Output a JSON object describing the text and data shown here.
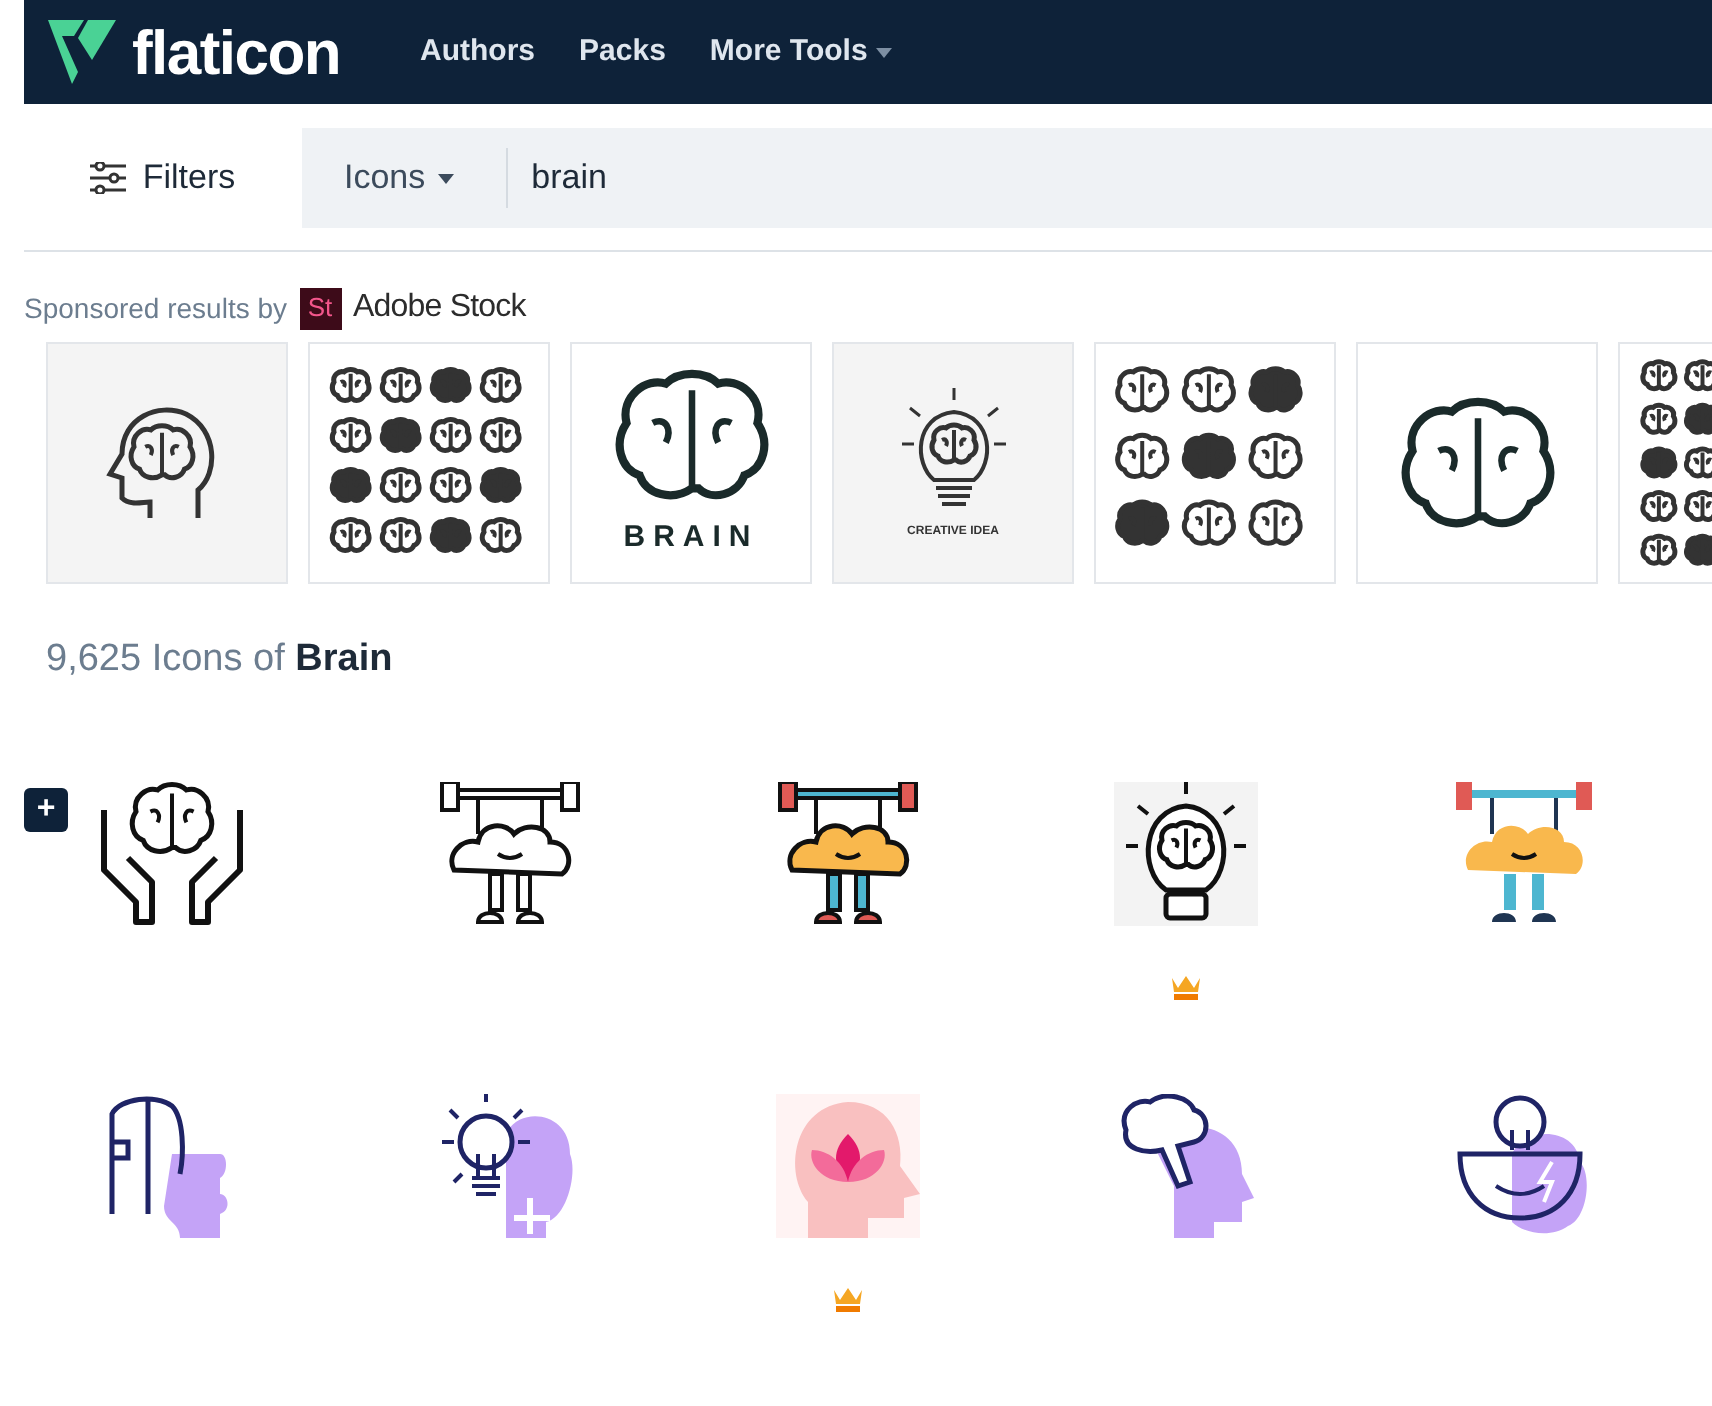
{
  "header": {
    "logo": "flaticon",
    "nav": [
      {
        "label": "Authors",
        "dropdown": false
      },
      {
        "label": "Packs",
        "dropdown": false
      },
      {
        "label": "More Tools",
        "dropdown": true
      }
    ]
  },
  "search": {
    "filters": "Filters",
    "type": "Icons",
    "value": "brain"
  },
  "sponsored": {
    "label": "Sponsored results by",
    "badge": "St",
    "brand": "Adobe Stock",
    "thumbs": [
      {
        "kind": "head"
      },
      {
        "kind": "grid16"
      },
      {
        "kind": "brain",
        "caption": "BRAIN"
      },
      {
        "kind": "bulb",
        "caption": "CREATIVE IDEA"
      },
      {
        "kind": "grid9"
      },
      {
        "kind": "brain"
      },
      {
        "kind": "grid-small"
      }
    ]
  },
  "results": {
    "count": "9,625",
    "text": "Icons of",
    "term": "Brain",
    "add_button": "+",
    "icons": [
      {
        "kind": "hands-brain",
        "premium": false
      },
      {
        "kind": "lifter-outline",
        "premium": false
      },
      {
        "kind": "lifter-color",
        "premium": false
      },
      {
        "kind": "bulb-brain",
        "premium": true
      },
      {
        "kind": "lifter-flat",
        "premium": false
      },
      {
        "kind": "puzzle-head",
        "premium": false
      },
      {
        "kind": "bulb-gear",
        "premium": false
      },
      {
        "kind": "lotus-head",
        "premium": true
      },
      {
        "kind": "brain-head",
        "premium": false
      },
      {
        "kind": "bowl-bulb",
        "premium": false
      }
    ]
  }
}
